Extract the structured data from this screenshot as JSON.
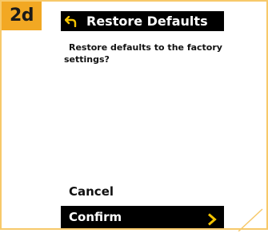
{
  "step": {
    "label": "2d",
    "color": "#f2a823"
  },
  "screen": {
    "title": "Restore Defaults",
    "back_icon": "back-arrow-icon",
    "message": "Restore defaults to the factory settings?",
    "options": [
      {
        "label": "Cancel",
        "selected": false
      },
      {
        "label": "Confirm",
        "selected": true,
        "icon": "chevron-right-icon"
      }
    ],
    "accent_color": "#f5c400"
  }
}
